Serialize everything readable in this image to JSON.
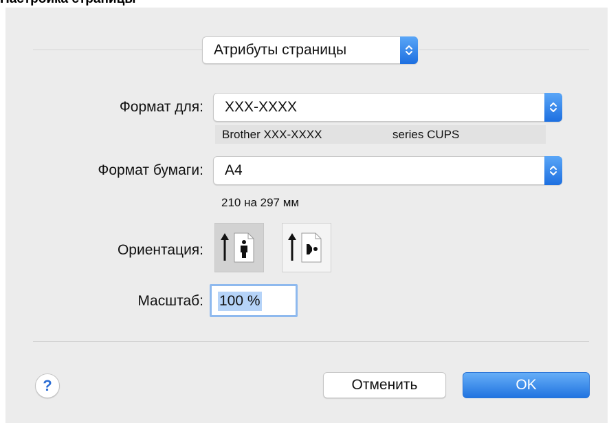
{
  "document": {
    "heading": "Настройка страницы"
  },
  "dialog": {
    "section_selector": {
      "value": "Атрибуты страницы",
      "icon": "updown-chevron-icon"
    },
    "format_for": {
      "label": "Формат для:",
      "value": "XXX-XXXX",
      "description_brand": "Brother XXX-XXXX",
      "description_series": "series CUPS"
    },
    "paper_size": {
      "label": "Формат бумаги:",
      "value": "A4",
      "dimensions": "210 на 297 мм"
    },
    "orientation": {
      "label": "Ориентация:",
      "options": [
        {
          "name": "portrait",
          "icon": "portrait-orientation-icon",
          "selected": true
        },
        {
          "name": "landscape",
          "icon": "landscape-orientation-icon",
          "selected": false
        }
      ]
    },
    "scale": {
      "label": "Масштаб:",
      "value": "100 %"
    },
    "help_symbol": "?",
    "cancel_label": "Отменить",
    "ok_label": "OK"
  },
  "colors": {
    "accent": "#2174e0",
    "panel_background": "#ececec",
    "focus_ring": "#8eb9ee",
    "selection": "#b5d3f8"
  }
}
